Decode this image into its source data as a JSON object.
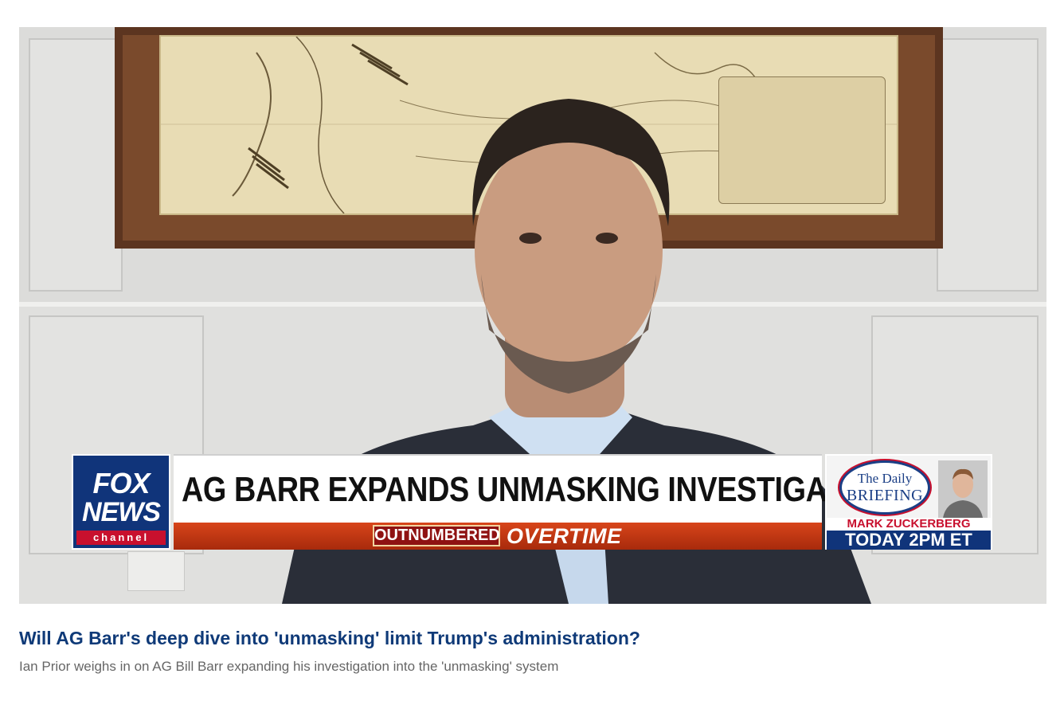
{
  "video": {
    "chyron": {
      "logo_top": "FOX",
      "logo_bottom": "NEWS",
      "logo_channel": "channel",
      "headline": "AG BARR EXPANDS UNMASKING INVESTIGATION",
      "show_name": "OUTNUMBERED",
      "show_suffix": "OVERTIME"
    },
    "promo": {
      "badge_line1": "The Daily",
      "badge_line2": "BRIEFING",
      "guest": "MARK ZUCKERBERG",
      "time": "TODAY 2PM ET"
    }
  },
  "article": {
    "title": "Will AG Barr's deep dive into 'unmasking' limit Trump's administration?",
    "description": "Ian Prior weighs in on AG Bill Barr expanding his investigation into the 'unmasking' system"
  },
  "colors": {
    "title": "#0f3a78",
    "fox_blue": "#10347a",
    "fox_red": "#c8102e",
    "show_bar": "#c13a14"
  }
}
